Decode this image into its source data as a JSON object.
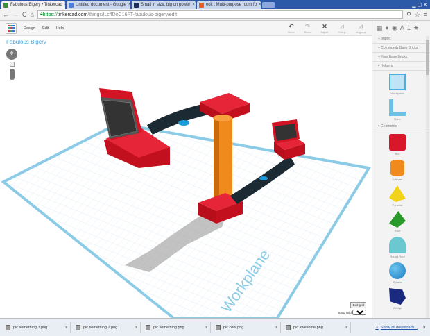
{
  "browser": {
    "tabs": [
      {
        "title": "Fabulous Bigery • Tinkercad",
        "active": true,
        "color": "#3a8f3a"
      },
      {
        "title": "Untitled document - Google",
        "color": "#4a7fe0"
      },
      {
        "title": "Small in size, big on power",
        "color": "#1a2a5a"
      },
      {
        "title": "edit : Multi-purpose room fo",
        "color": "#e06030"
      }
    ],
    "url": {
      "scheme": "https://",
      "host": "tinkercad.com",
      "path": "/things/lLc4DoC16FT-fabulous-bigery/edit"
    }
  },
  "toolbar": {
    "menus": [
      "Design",
      "Edit",
      "Help"
    ],
    "tools": [
      {
        "icon": "↶",
        "label": "Undo"
      },
      {
        "icon": "↷",
        "label": "Redo"
      },
      {
        "icon": "✕",
        "label": "Adjust"
      },
      {
        "icon": "⊿",
        "label": "Group"
      },
      {
        "icon": "⊿",
        "label": "Ungroup"
      }
    ]
  },
  "canvas": {
    "title": "Fabulous Bigery",
    "plane_label": "Workplane",
    "edit_grid": "Edit grid",
    "snap_label": "Snap grid",
    "snap_value": "1.0"
  },
  "sidebar": {
    "icons": [
      "▦",
      "●",
      "◉",
      "A",
      "1",
      "★"
    ],
    "sections": {
      "import": "+ Import",
      "community": "+ Community Base Bricks",
      "yours": "+ Your Base Bricks",
      "helpers": "▾ Helpers",
      "geometric": "▾ Geometric"
    },
    "helpers": [
      {
        "label": "Workplane"
      },
      {
        "label": "Ruler"
      }
    ],
    "shapes": [
      {
        "label": "Box",
        "color": "#d8182a"
      },
      {
        "label": "Cylinder",
        "color": "#f08a1c"
      },
      {
        "label": "Pyramid",
        "color": "#f2d21a"
      },
      {
        "label": "Roof",
        "color": "#2a9a2a"
      },
      {
        "label": "Round Roof",
        "color": "#6cc8d0"
      },
      {
        "label": "Sphere",
        "color": "#1a8ad0"
      },
      {
        "label": "Wedge",
        "color": "#1a2a80"
      }
    ]
  },
  "downloads": {
    "files": [
      "pic something 3.png",
      "pic something 2.png",
      "pic something.png",
      "pic cool.png",
      "pic awesome.png"
    ],
    "show_all": "Show all downloads..."
  }
}
